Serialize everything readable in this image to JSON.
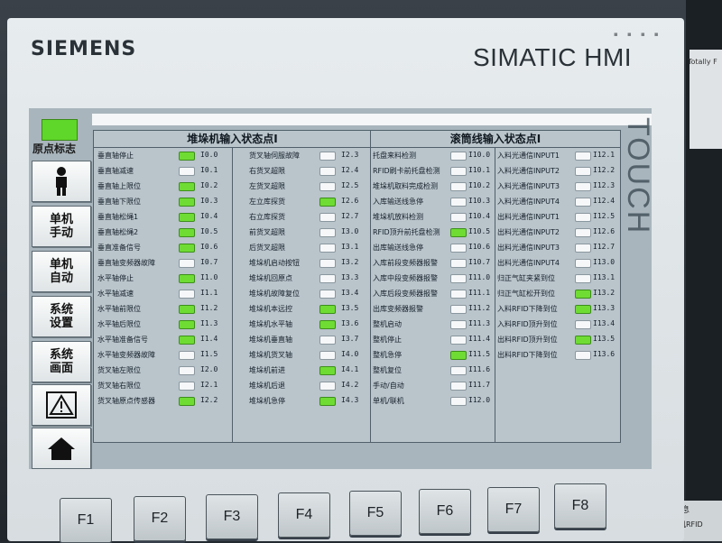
{
  "header": {
    "brand": "SIEMENS",
    "product": "SIMATIC HMI",
    "side_text": "TOUCH"
  },
  "left_nav": {
    "origin_label": "原点标志",
    "buttons": [
      {
        "id": "person",
        "label": ""
      },
      {
        "id": "manual",
        "line1": "单机",
        "line2": "手动"
      },
      {
        "id": "auto",
        "line1": "单机",
        "line2": "自动"
      },
      {
        "id": "settings",
        "line1": "系统",
        "line2": "设置"
      },
      {
        "id": "screen",
        "line1": "系统",
        "line2": "画面"
      },
      {
        "id": "alarm",
        "label": ""
      },
      {
        "id": "home",
        "label": ""
      }
    ]
  },
  "stacker": {
    "title": "堆垛机输入状态点I",
    "col1": [
      {
        "label": "垂直轴停止",
        "addr": "I0.0",
        "on": true
      },
      {
        "label": "垂直轴减速",
        "addr": "I0.1",
        "on": false
      },
      {
        "label": "垂直轴上限位",
        "addr": "I0.2",
        "on": true
      },
      {
        "label": "垂直轴下限位",
        "addr": "I0.3",
        "on": true
      },
      {
        "label": "垂直轴松绳1",
        "addr": "I0.4",
        "on": true
      },
      {
        "label": "垂直轴松绳2",
        "addr": "I0.5",
        "on": true
      },
      {
        "label": "垂直准备信号",
        "addr": "I0.6",
        "on": true
      },
      {
        "label": "垂直轴变频器故障",
        "addr": "I0.7",
        "on": false
      },
      {
        "label": "水平轴停止",
        "addr": "I1.0",
        "on": true
      },
      {
        "label": "水平轴减速",
        "addr": "I1.1",
        "on": false
      },
      {
        "label": "水平轴前限位",
        "addr": "I1.2",
        "on": true
      },
      {
        "label": "水平轴后限位",
        "addr": "I1.3",
        "on": true
      },
      {
        "label": "水平轴准备信号",
        "addr": "I1.4",
        "on": true
      },
      {
        "label": "水平轴变频器故障",
        "addr": "I1.5",
        "on": false
      },
      {
        "label": "货叉轴左限位",
        "addr": "I2.0",
        "on": false
      },
      {
        "label": "货叉轴右限位",
        "addr": "I2.1",
        "on": false
      },
      {
        "label": "货叉轴原点传感器",
        "addr": "I2.2",
        "on": true
      }
    ],
    "col2": [
      {
        "label": "货叉轴伺服故障",
        "addr": "I2.3",
        "on": false
      },
      {
        "label": "右货叉超限",
        "addr": "I2.4",
        "on": false
      },
      {
        "label": "左货叉超限",
        "addr": "I2.5",
        "on": false
      },
      {
        "label": "左立库探货",
        "addr": "I2.6",
        "on": true
      },
      {
        "label": "右立库探货",
        "addr": "I2.7",
        "on": false
      },
      {
        "label": "前货叉超限",
        "addr": "I3.0",
        "on": false
      },
      {
        "label": "后货叉超限",
        "addr": "I3.1",
        "on": false
      },
      {
        "label": "堆垛机启动按钮",
        "addr": "I3.2",
        "on": false
      },
      {
        "label": "堆垛机回原点",
        "addr": "I3.3",
        "on": false
      },
      {
        "label": "堆垛机故障复位",
        "addr": "I3.4",
        "on": false
      },
      {
        "label": "堆垛机本远控",
        "addr": "I3.5",
        "on": true
      },
      {
        "label": "堆垛机水平轴",
        "addr": "I3.6",
        "on": true
      },
      {
        "label": "堆垛机垂直轴",
        "addr": "I3.7",
        "on": false
      },
      {
        "label": "堆垛机货叉轴",
        "addr": "I4.0",
        "on": false
      },
      {
        "label": "堆垛机前进",
        "addr": "I4.1",
        "on": true
      },
      {
        "label": "堆垛机后退",
        "addr": "I4.2",
        "on": false
      },
      {
        "label": "堆垛机急停",
        "addr": "I4.3",
        "on": true
      }
    ]
  },
  "conveyor": {
    "title": "滚筒线输入状态点I",
    "col1": [
      {
        "label": "托盘来料检测",
        "addr": "I10.0",
        "on": false
      },
      {
        "label": "RFID刷卡前托盘检测",
        "addr": "I10.1",
        "on": false
      },
      {
        "label": "堆垛机取料完成检测",
        "addr": "I10.2",
        "on": false
      },
      {
        "label": "入库输送线急停",
        "addr": "I10.3",
        "on": false
      },
      {
        "label": "堆垛机放料检测",
        "addr": "I10.4",
        "on": false
      },
      {
        "label": "RFID顶升前托盘检测",
        "addr": "I10.5",
        "on": true
      },
      {
        "label": "出库输送线急停",
        "addr": "I10.6",
        "on": false
      },
      {
        "label": "入库前段变频器报警",
        "addr": "I10.7",
        "on": false
      },
      {
        "label": "入库中段变频器报警",
        "addr": "I11.0",
        "on": false
      },
      {
        "label": "入库后段变频器报警",
        "addr": "I11.1",
        "on": false
      },
      {
        "label": "出库变频器报警",
        "addr": "I11.2",
        "on": false
      },
      {
        "label": "整机启动",
        "addr": "I11.3",
        "on": false
      },
      {
        "label": "整机停止",
        "addr": "I11.4",
        "on": false
      },
      {
        "label": "整机急停",
        "addr": "I11.5",
        "on": true
      },
      {
        "label": "整机复位",
        "addr": "I11.6",
        "on": false
      },
      {
        "label": "手动/自动",
        "addr": "I11.7",
        "on": false
      },
      {
        "label": "单机/联机",
        "addr": "I12.0",
        "on": false
      }
    ],
    "col2": [
      {
        "label": "入料光通信INPUT1",
        "addr": "I12.1",
        "on": false
      },
      {
        "label": "入料光通信INPUT2",
        "addr": "I12.2",
        "on": false
      },
      {
        "label": "入料光通信INPUT3",
        "addr": "I12.3",
        "on": false
      },
      {
        "label": "入料光通信INPUT4",
        "addr": "I12.4",
        "on": false
      },
      {
        "label": "出料光通信INPUT1",
        "addr": "I12.5",
        "on": false
      },
      {
        "label": "出料光通信INPUT2",
        "addr": "I12.6",
        "on": false
      },
      {
        "label": "出料光通信INPUT3",
        "addr": "I12.7",
        "on": false
      },
      {
        "label": "出料光通信INPUT4",
        "addr": "I13.0",
        "on": false
      },
      {
        "label": "归正气缸夹紧到位",
        "addr": "I13.1",
        "on": false
      },
      {
        "label": "归正气缸松开到位",
        "addr": "I13.2",
        "on": true
      },
      {
        "label": "入料RFID下降到位",
        "addr": "I13.3",
        "on": true
      },
      {
        "label": "入料RFID顶升到位",
        "addr": "I13.4",
        "on": false
      },
      {
        "label": "出料RFID顶升到位",
        "addr": "I13.5",
        "on": true
      },
      {
        "label": "出料RFID下降到位",
        "addr": "I13.6",
        "on": false
      }
    ]
  },
  "fkeys": [
    "F1",
    "F2",
    "F3",
    "F4",
    "F5",
    "F6",
    "F7",
    "F8"
  ],
  "side_window": {
    "text1": "Totally F",
    "text2": "信息",
    "text3": "送机RFID"
  },
  "colors": {
    "led_on": "#6fdc34",
    "led_off": "#f5f7f8"
  }
}
